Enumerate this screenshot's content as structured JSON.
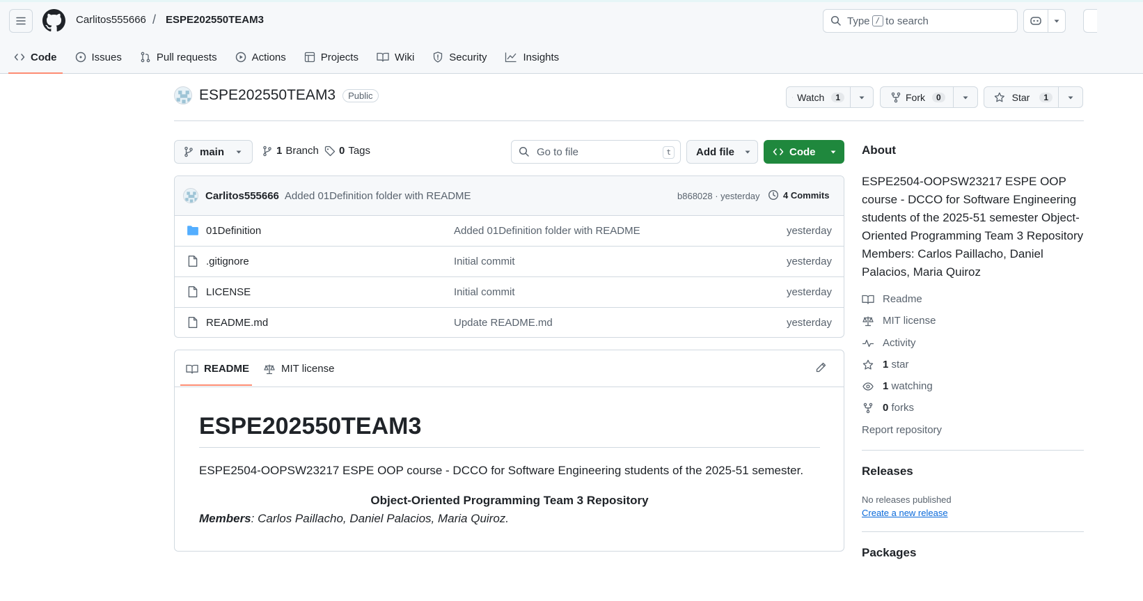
{
  "header": {
    "owner": "Carlitos555666",
    "slash": "/",
    "repo": "ESPE202550TEAM3",
    "search_prefix": "Type",
    "search_key": "/",
    "search_suffix": "to search"
  },
  "tabs": [
    {
      "label": "Code",
      "icon": "code-icon",
      "active": true
    },
    {
      "label": "Issues",
      "icon": "issue-opened-icon"
    },
    {
      "label": "Pull requests",
      "icon": "git-pull-request-icon"
    },
    {
      "label": "Actions",
      "icon": "play-icon"
    },
    {
      "label": "Projects",
      "icon": "table-icon"
    },
    {
      "label": "Wiki",
      "icon": "book-icon"
    },
    {
      "label": "Security",
      "icon": "shield-icon"
    },
    {
      "label": "Insights",
      "icon": "graph-icon"
    }
  ],
  "repo_header": {
    "title": "ESPE202550TEAM3",
    "visibility": "Public",
    "watch_label": "Watch",
    "watch_count": "1",
    "fork_label": "Fork",
    "fork_count": "0",
    "star_label": "Star",
    "star_count": "1"
  },
  "toolbar": {
    "branch": "main",
    "branches_count": "1",
    "branches_label": "Branch",
    "tags_count": "0",
    "tags_label": "Tags",
    "goto_placeholder": "Go to file",
    "goto_key": "t",
    "add_file_label": "Add file",
    "code_label": "Code"
  },
  "commit": {
    "author": "Carlitos555666",
    "message": "Added 01Definition folder with README",
    "hash_time": "b868028 · yesterday",
    "commits_label": "4 Commits"
  },
  "files": [
    {
      "name": "01Definition",
      "type": "folder",
      "message": "Added 01Definition folder with README",
      "time": "yesterday"
    },
    {
      "name": ".gitignore",
      "type": "file",
      "message": "Initial commit",
      "time": "yesterday"
    },
    {
      "name": "LICENSE",
      "type": "file",
      "message": "Initial commit",
      "time": "yesterday"
    },
    {
      "name": "README.md",
      "type": "file",
      "message": "Update README.md",
      "time": "yesterday"
    }
  ],
  "readme": {
    "tab_readme": "README",
    "tab_license": "MIT license",
    "heading": "ESPE202550TEAM3",
    "paragraph": "ESPE2504-OOPSW23217 ESPE OOP course - DCCO for Software Engineering students of the 2025-51 semester.",
    "center_bold": "Object-Oriented Programming Team 3 Repository",
    "members_label": "Members",
    "members_text": ": Carlos Paillacho, Daniel Palacios, Maria Quiroz."
  },
  "about": {
    "heading": "About",
    "description": "ESPE2504-OOPSW23217 ESPE OOP course - DCCO for Software Engineering students of the 2025-51 semester Object-Oriented Programming Team 3 Repository Members: Carlos Paillacho, Daniel Palacios, Maria Quiroz",
    "readme": "Readme",
    "license": "MIT license",
    "activity": "Activity",
    "stars_count": "1",
    "stars_label": "star",
    "watching_count": "1",
    "watching_label": "watching",
    "forks_count": "0",
    "forks_label": "forks",
    "report": "Report repository"
  },
  "releases": {
    "heading": "Releases",
    "none": "No releases published",
    "create": "Create a new release"
  },
  "packages": {
    "heading": "Packages"
  },
  "colors": {
    "accent_green": "#1f883d",
    "tab_underline": "#fd8c73",
    "link_blue": "#0969da",
    "folder_blue": "#54aeff"
  }
}
